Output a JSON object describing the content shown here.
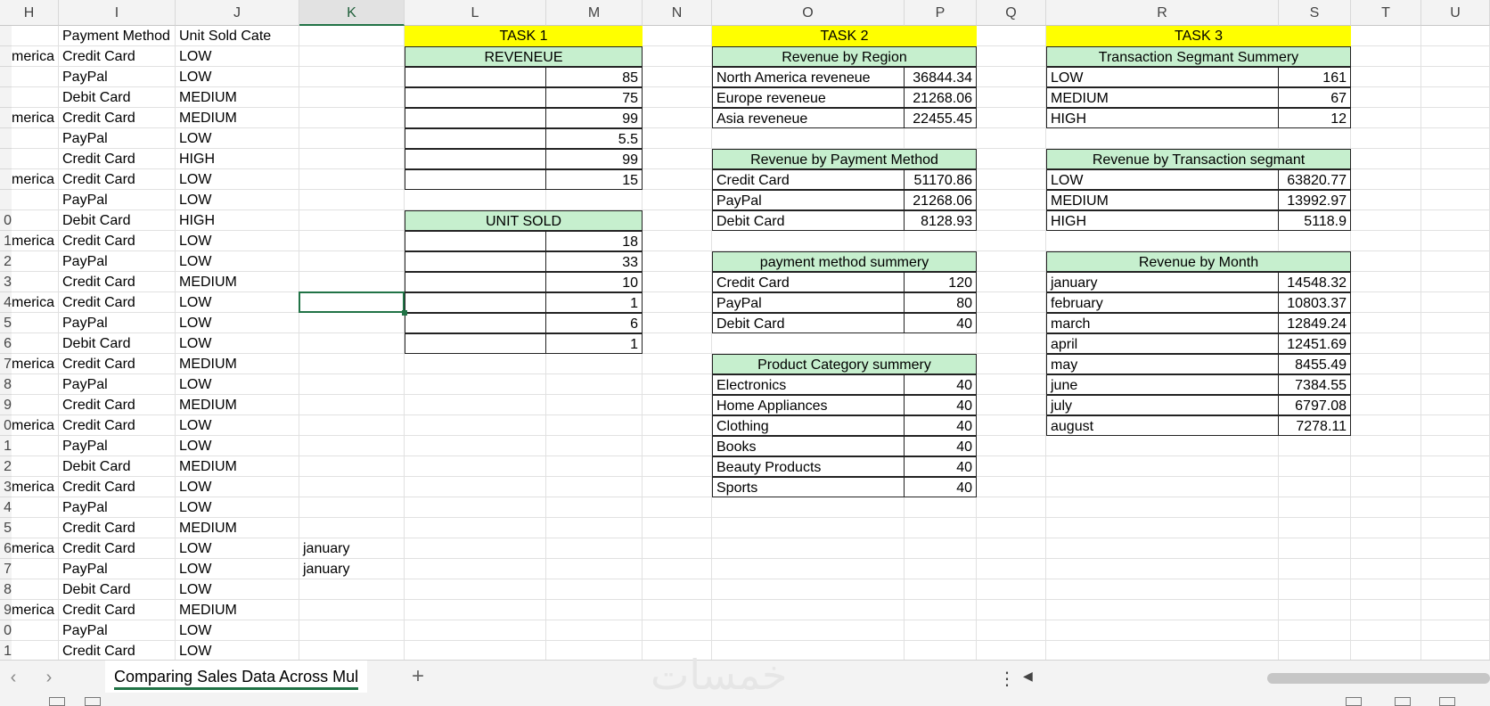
{
  "columns": {
    "H": "H",
    "I": "I",
    "J": "J",
    "K": "K",
    "L": "L",
    "M": "M",
    "N": "N",
    "O": "O",
    "P": "P",
    "Q": "Q",
    "R": "R",
    "S": "S",
    "T": "T",
    "U": "U"
  },
  "row_numbers": [
    "",
    "",
    "",
    "",
    "",
    "",
    "",
    "",
    "",
    "0",
    "1",
    "2",
    "3",
    "4",
    "5",
    "6",
    "7",
    "8",
    "9",
    "0",
    "1",
    "2",
    "3",
    "4",
    "5",
    "6",
    "7",
    "8",
    "9",
    "0",
    "1"
  ],
  "data_rows": [
    {
      "region": "",
      "payment": "Payment Method",
      "unit": "Unit Sold Cate",
      "k": ""
    },
    {
      "region": "merica",
      "payment": "Credit Card",
      "unit": "LOW",
      "k": ""
    },
    {
      "region": "",
      "payment": "PayPal",
      "unit": "LOW",
      "k": ""
    },
    {
      "region": "",
      "payment": "Debit Card",
      "unit": "MEDIUM",
      "k": ""
    },
    {
      "region": "merica",
      "payment": "Credit Card",
      "unit": "MEDIUM",
      "k": ""
    },
    {
      "region": "",
      "payment": "PayPal",
      "unit": "LOW",
      "k": ""
    },
    {
      "region": "",
      "payment": "Credit Card",
      "unit": "HIGH",
      "k": ""
    },
    {
      "region": "merica",
      "payment": "Credit Card",
      "unit": "LOW",
      "k": ""
    },
    {
      "region": "",
      "payment": "PayPal",
      "unit": "LOW",
      "k": ""
    },
    {
      "region": "",
      "payment": "Debit Card",
      "unit": "HIGH",
      "k": ""
    },
    {
      "region": "merica",
      "payment": "Credit Card",
      "unit": "LOW",
      "k": ""
    },
    {
      "region": "",
      "payment": "PayPal",
      "unit": "LOW",
      "k": ""
    },
    {
      "region": "",
      "payment": "Credit Card",
      "unit": "MEDIUM",
      "k": ""
    },
    {
      "region": "merica",
      "payment": "Credit Card",
      "unit": "LOW",
      "k": ""
    },
    {
      "region": "",
      "payment": "PayPal",
      "unit": "LOW",
      "k": ""
    },
    {
      "region": "",
      "payment": "Debit Card",
      "unit": "LOW",
      "k": ""
    },
    {
      "region": "merica",
      "payment": "Credit Card",
      "unit": "MEDIUM",
      "k": ""
    },
    {
      "region": "",
      "payment": "PayPal",
      "unit": "LOW",
      "k": ""
    },
    {
      "region": "",
      "payment": "Credit Card",
      "unit": "MEDIUM",
      "k": ""
    },
    {
      "region": "merica",
      "payment": "Credit Card",
      "unit": "LOW",
      "k": ""
    },
    {
      "region": "",
      "payment": "PayPal",
      "unit": "LOW",
      "k": ""
    },
    {
      "region": "",
      "payment": "Debit Card",
      "unit": "MEDIUM",
      "k": ""
    },
    {
      "region": "merica",
      "payment": "Credit Card",
      "unit": "LOW",
      "k": ""
    },
    {
      "region": "",
      "payment": "PayPal",
      "unit": "LOW",
      "k": ""
    },
    {
      "region": "",
      "payment": "Credit Card",
      "unit": "MEDIUM",
      "k": ""
    },
    {
      "region": "merica",
      "payment": "Credit Card",
      "unit": "LOW",
      "k": "january"
    },
    {
      "region": "",
      "payment": "PayPal",
      "unit": "LOW",
      "k": "january"
    },
    {
      "region": "",
      "payment": "Debit Card",
      "unit": "LOW",
      "k": ""
    },
    {
      "region": "merica",
      "payment": "Credit Card",
      "unit": "MEDIUM",
      "k": ""
    },
    {
      "region": "",
      "payment": "PayPal",
      "unit": "LOW",
      "k": ""
    },
    {
      "region": "",
      "payment": "Credit Card",
      "unit": "LOW",
      "k": ""
    }
  ],
  "task1": {
    "title": "TASK 1",
    "revenue_header": "REVENEUE",
    "revenue_values": [
      "85",
      "75",
      "99",
      "5.5",
      "99",
      "15"
    ],
    "units_header": "UNIT SOLD",
    "unit_values": [
      "18",
      "33",
      "10",
      "1",
      "6",
      "1"
    ]
  },
  "task2": {
    "title": "TASK 2",
    "region_header": "Revenue by Region",
    "region_rows": [
      {
        "label": "North America reveneue",
        "value": "36844.34"
      },
      {
        "label": "Europe reveneue",
        "value": "21268.06"
      },
      {
        "label": "Asia reveneue",
        "value": "22455.45"
      }
    ],
    "payment_header": "Revenue by Payment Method",
    "payment_rows": [
      {
        "label": "Credit Card",
        "value": "51170.86"
      },
      {
        "label": "PayPal",
        "value": "21268.06"
      },
      {
        "label": "Debit Card",
        "value": "8128.93"
      }
    ],
    "pm_summary_header": "payment method summery",
    "pm_summary_rows": [
      {
        "label": "Credit Card",
        "value": "120"
      },
      {
        "label": "PayPal",
        "value": "80"
      },
      {
        "label": "Debit Card",
        "value": "40"
      }
    ],
    "category_header": "Product Category summery",
    "category_rows": [
      {
        "label": "Electronics",
        "value": "40"
      },
      {
        "label": "Home Appliances",
        "value": "40"
      },
      {
        "label": "Clothing",
        "value": "40"
      },
      {
        "label": "Books",
        "value": "40"
      },
      {
        "label": "Beauty Products",
        "value": "40"
      },
      {
        "label": "Sports",
        "value": "40"
      }
    ]
  },
  "task3": {
    "title": "TASK 3",
    "segment_header": "Transaction Segmant Summery",
    "segment_rows": [
      {
        "label": "LOW",
        "value": "161"
      },
      {
        "label": "MEDIUM",
        "value": "67"
      },
      {
        "label": "HIGH",
        "value": "12"
      }
    ],
    "seg_revenue_header": "Revenue by Transaction segmant",
    "seg_revenue_rows": [
      {
        "label": "LOW",
        "value": "63820.77"
      },
      {
        "label": "MEDIUM",
        "value": "13992.97"
      },
      {
        "label": "HIGH",
        "value": "5118.9"
      }
    ],
    "month_header": "Revenue by Month",
    "month_rows": [
      {
        "label": "january",
        "value": "14548.32"
      },
      {
        "label": "february",
        "value": "10803.37"
      },
      {
        "label": "march",
        "value": "12849.24"
      },
      {
        "label": "april",
        "value": "12451.69"
      },
      {
        "label": "may",
        "value": "8455.49"
      },
      {
        "label": "june",
        "value": "7384.55"
      },
      {
        "label": "july",
        "value": "6797.08"
      },
      {
        "label": "august",
        "value": "7278.11"
      }
    ]
  },
  "tabs": {
    "sheet_name": "Comparing Sales Data Across Mul",
    "add_sheet": "+",
    "prev": "‹",
    "next": "›",
    "more": "⋮",
    "scroll_left": "◀"
  },
  "watermark": "خمسات",
  "colors": {
    "task_header": "#ffff00",
    "table_header": "#c6efce",
    "selection": "#217346"
  }
}
